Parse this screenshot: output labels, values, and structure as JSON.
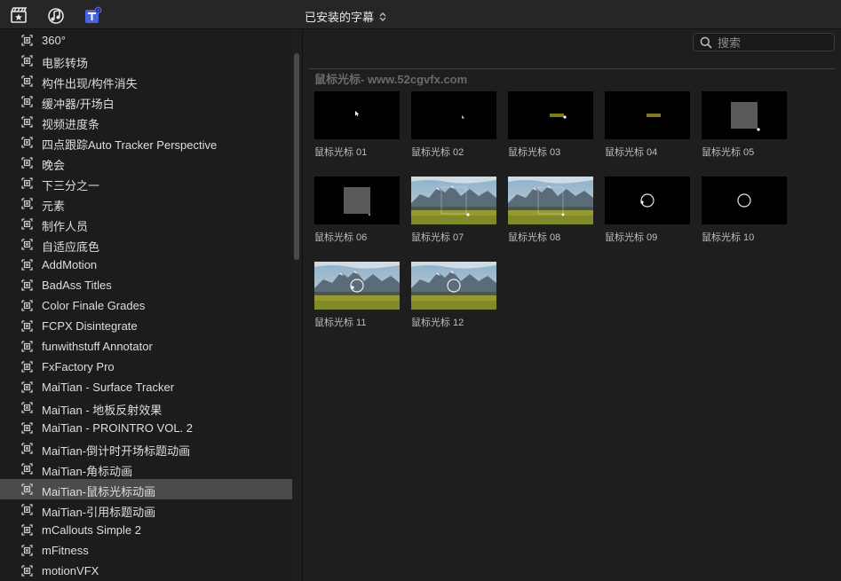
{
  "toolbar": {
    "icons": [
      "clapper-star-icon",
      "music-notes-icon",
      "titles-icon"
    ],
    "title": "已安装的字幕",
    "title_chevron": "⌃⌄"
  },
  "sidebar": {
    "items": [
      {
        "label": "360°"
      },
      {
        "label": "电影转场"
      },
      {
        "label": "构件出现/构件消失"
      },
      {
        "label": "缓冲器/开场白"
      },
      {
        "label": "视频进度条"
      },
      {
        "label": "四点跟踪Auto Tracker Perspective"
      },
      {
        "label": "晚会"
      },
      {
        "label": "下三分之一"
      },
      {
        "label": "元素"
      },
      {
        "label": "制作人员"
      },
      {
        "label": "自适应底色"
      },
      {
        "label": "AddMotion"
      },
      {
        "label": "BadAss Titles"
      },
      {
        "label": "Color Finale Grades"
      },
      {
        "label": "FCPX Disintegrate"
      },
      {
        "label": "funwithstuff Annotator"
      },
      {
        "label": "FxFactory Pro"
      },
      {
        "label": "MaiTian -  Surface Tracker"
      },
      {
        "label": "MaiTian - 地板反射效果"
      },
      {
        "label": "MaiTian - PROINTRO VOL. 2"
      },
      {
        "label": "MaiTian-倒计时开场标题动画"
      },
      {
        "label": "MaiTian-角标动画"
      },
      {
        "label": "MaiTian-鼠标光标动画",
        "selected": true
      },
      {
        "label": "MaiTian-引用标题动画"
      },
      {
        "label": "mCallouts Simple 2"
      },
      {
        "label": "mFitness"
      },
      {
        "label": "motionVFX"
      }
    ]
  },
  "search": {
    "placeholder": "搜索",
    "value": ""
  },
  "browser": {
    "group_header": "鼠标光标- www.52cgvfx.com",
    "tiles": [
      {
        "label": "鼠标光标 01",
        "kind": "dark"
      },
      {
        "label": "鼠标光标 02",
        "kind": "dark"
      },
      {
        "label": "鼠标光标 03",
        "kind": "dark"
      },
      {
        "label": "鼠标光标 04",
        "kind": "dark"
      },
      {
        "label": "鼠标光标 05",
        "kind": "dark"
      },
      {
        "label": "鼠标光标 06",
        "kind": "dark"
      },
      {
        "label": "鼠标光标 07",
        "kind": "landscape"
      },
      {
        "label": "鼠标光标 08",
        "kind": "landscape"
      },
      {
        "label": "鼠标光标 09",
        "kind": "dark"
      },
      {
        "label": "鼠标光标 10",
        "kind": "dark"
      },
      {
        "label": "鼠标光标 11",
        "kind": "landscape"
      },
      {
        "label": "鼠标光标 12",
        "kind": "landscape"
      }
    ]
  },
  "colors": {
    "background": "#1e1e1e",
    "sidebar_selected": "#4b4b4b",
    "titles_icon_accent": "#4a63e0",
    "bar_yellow": "#7f7a1e"
  }
}
